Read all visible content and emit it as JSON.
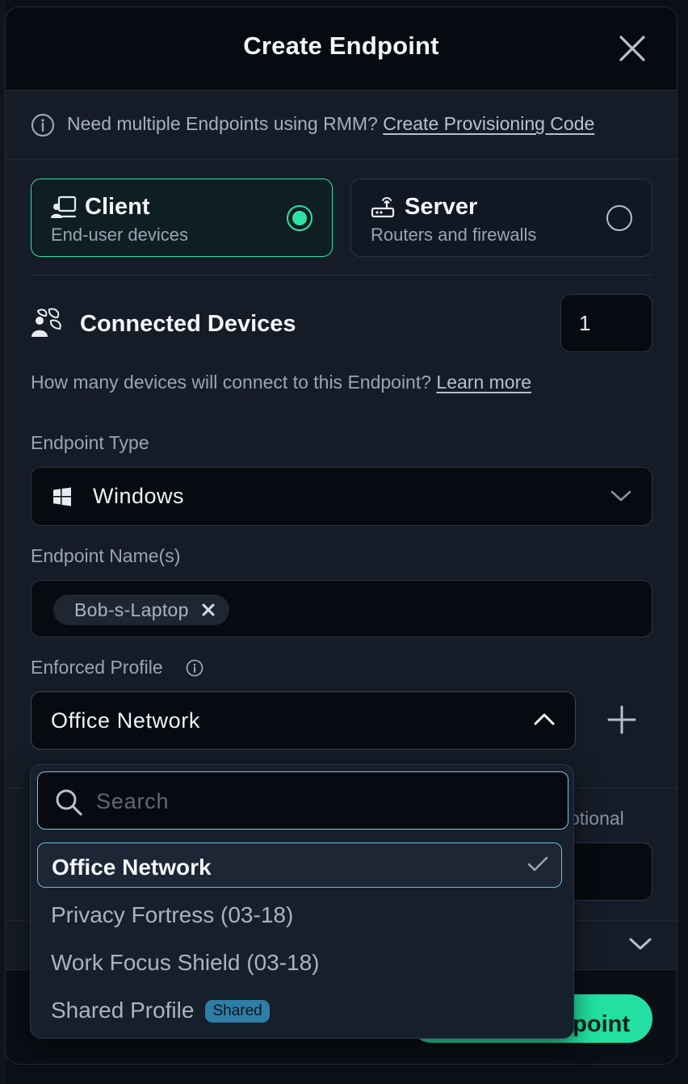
{
  "modal": {
    "title": "Create Endpoint"
  },
  "banner": {
    "text": "Need multiple Endpoints using RMM?",
    "link": "Create Provisioning Code"
  },
  "endpoint_kinds": [
    {
      "title": "Client",
      "subtitle": "End-user devices",
      "selected": true
    },
    {
      "title": "Server",
      "subtitle": "Routers and firewalls",
      "selected": false
    }
  ],
  "connected_devices": {
    "title": "Connected Devices",
    "count": "1",
    "helper": "How many devices will connect to this Endpoint?",
    "helper_link": "Learn more"
  },
  "endpoint_type": {
    "label": "Endpoint Type",
    "value": "Windows"
  },
  "endpoint_names": {
    "label": "Endpoint Name(s)",
    "tags": [
      "Bob-s-Laptop"
    ]
  },
  "enforced_profile": {
    "label": "Enforced Profile",
    "value": "Office Network"
  },
  "dropdown": {
    "search_placeholder": "Search",
    "options": [
      {
        "label": "Office Network",
        "selected": true,
        "badge": ""
      },
      {
        "label": "Privacy Fortress (03-18)",
        "selected": false,
        "badge": ""
      },
      {
        "label": "Work Focus Shield (03-18)",
        "selected": false,
        "badge": ""
      },
      {
        "label": "Shared Profile",
        "selected": false,
        "badge": "Shared"
      }
    ]
  },
  "background": {
    "optional_label": "otional",
    "primary_button_partial": "point"
  },
  "colors": {
    "accent": "#2ee2a6",
    "focus_border": "#7bc6e4",
    "badge": "#2f7ea6",
    "modal_bg": "#151c27",
    "header_bg": "#070a10"
  }
}
